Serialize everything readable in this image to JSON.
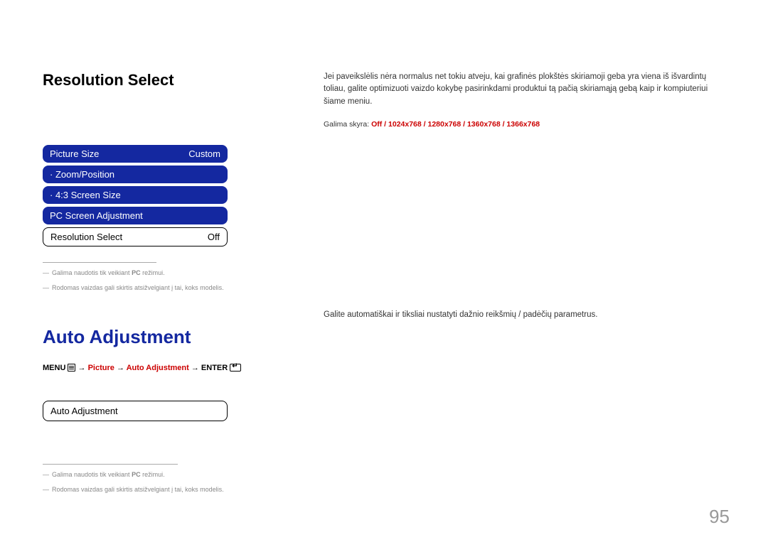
{
  "section1": {
    "title": "Resolution Select",
    "desc": "Jei paveikslėlis nėra normalus net tokiu atveju, kai grafinės plokštės skiriamoji geba yra viena iš išvardintų toliau, galite optimizuoti vaizdo kokybę pasirinkdami produktui tą pačią skiriamąją gebą kaip ir kompiuteriui šiame meniu.",
    "options_prefix": "Galima skyra: ",
    "options": "Off / 1024x768 / 1280x768 / 1360x768 / 1366x768"
  },
  "menu": {
    "item1_label": "Picture Size",
    "item1_value": "Custom",
    "item2_label": "· Zoom/Position",
    "item3_label": "· 4:3 Screen Size",
    "item4_label": "PC Screen Adjustment",
    "item5_label": "Resolution Select",
    "item5_value": "Off"
  },
  "footnotes": {
    "f1_pre": "Galima naudotis tik veikiant ",
    "f1_pc": "PC",
    "f1_post": " režimui.",
    "f2": "Rodomas vaizdas gali skirtis atsižvelgiant į tai, koks modelis."
  },
  "section2": {
    "title": "Auto Adjustment",
    "nav_menu": "MENU",
    "nav_picture": "Picture",
    "nav_auto": "Auto Adjustment",
    "nav_enter": "ENTER",
    "arrow": "→",
    "desc": "Galite automatiškai ir tiksliai nustatyti dažnio reikšmių / padėčių parametrus.",
    "box_label": "Auto Adjustment"
  },
  "page_number": "95"
}
